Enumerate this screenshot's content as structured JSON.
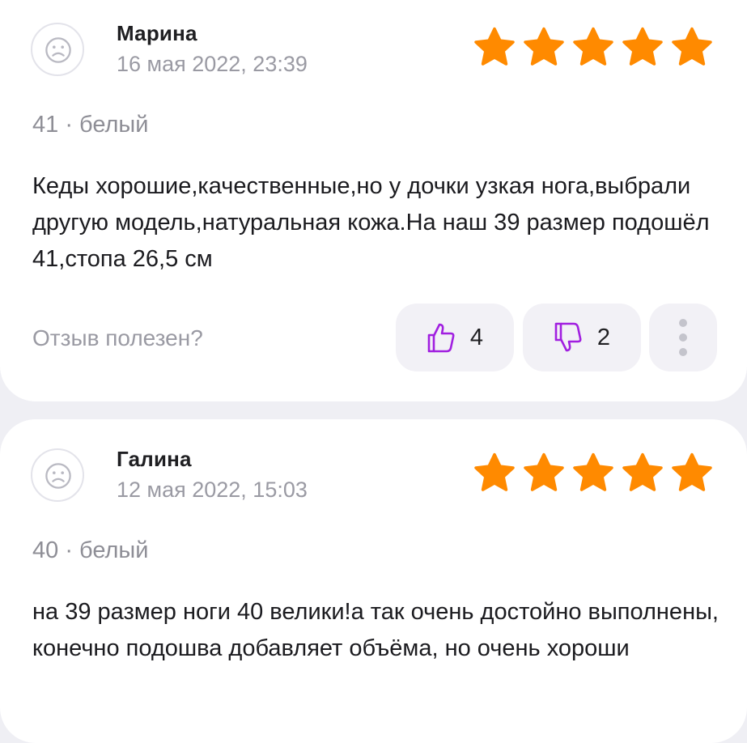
{
  "colors": {
    "star": "#ff8a00",
    "thumb_icon": "#a11fe0",
    "muted": "#9a9aa3"
  },
  "reviews": [
    {
      "author": "Марина",
      "date": "16 мая 2022, 23:39",
      "rating": 5,
      "variant": "41 · белый",
      "text": "Кеды хорошие,качественные,но у дочки узкая нога,выбрали другую модель,натуральная кожа.На наш 39 размер подошёл 41,стопа 26,5 см",
      "helpful_label": "Отзыв полезен?",
      "likes": "4",
      "dislikes": "2",
      "avatar_icon": "sad-face-icon",
      "like_icon": "thumb-up-icon",
      "dislike_icon": "thumb-down-icon",
      "more_icon": "vertical-dots-icon"
    },
    {
      "author": "Галина",
      "date": "12 мая 2022, 15:03",
      "rating": 5,
      "variant": "40 · белый",
      "text": "на 39 размер ноги 40 велики!а так очень достойно выполнены, конечно подошва добавляет объёма, но очень хороши",
      "avatar_icon": "sad-face-icon"
    }
  ]
}
